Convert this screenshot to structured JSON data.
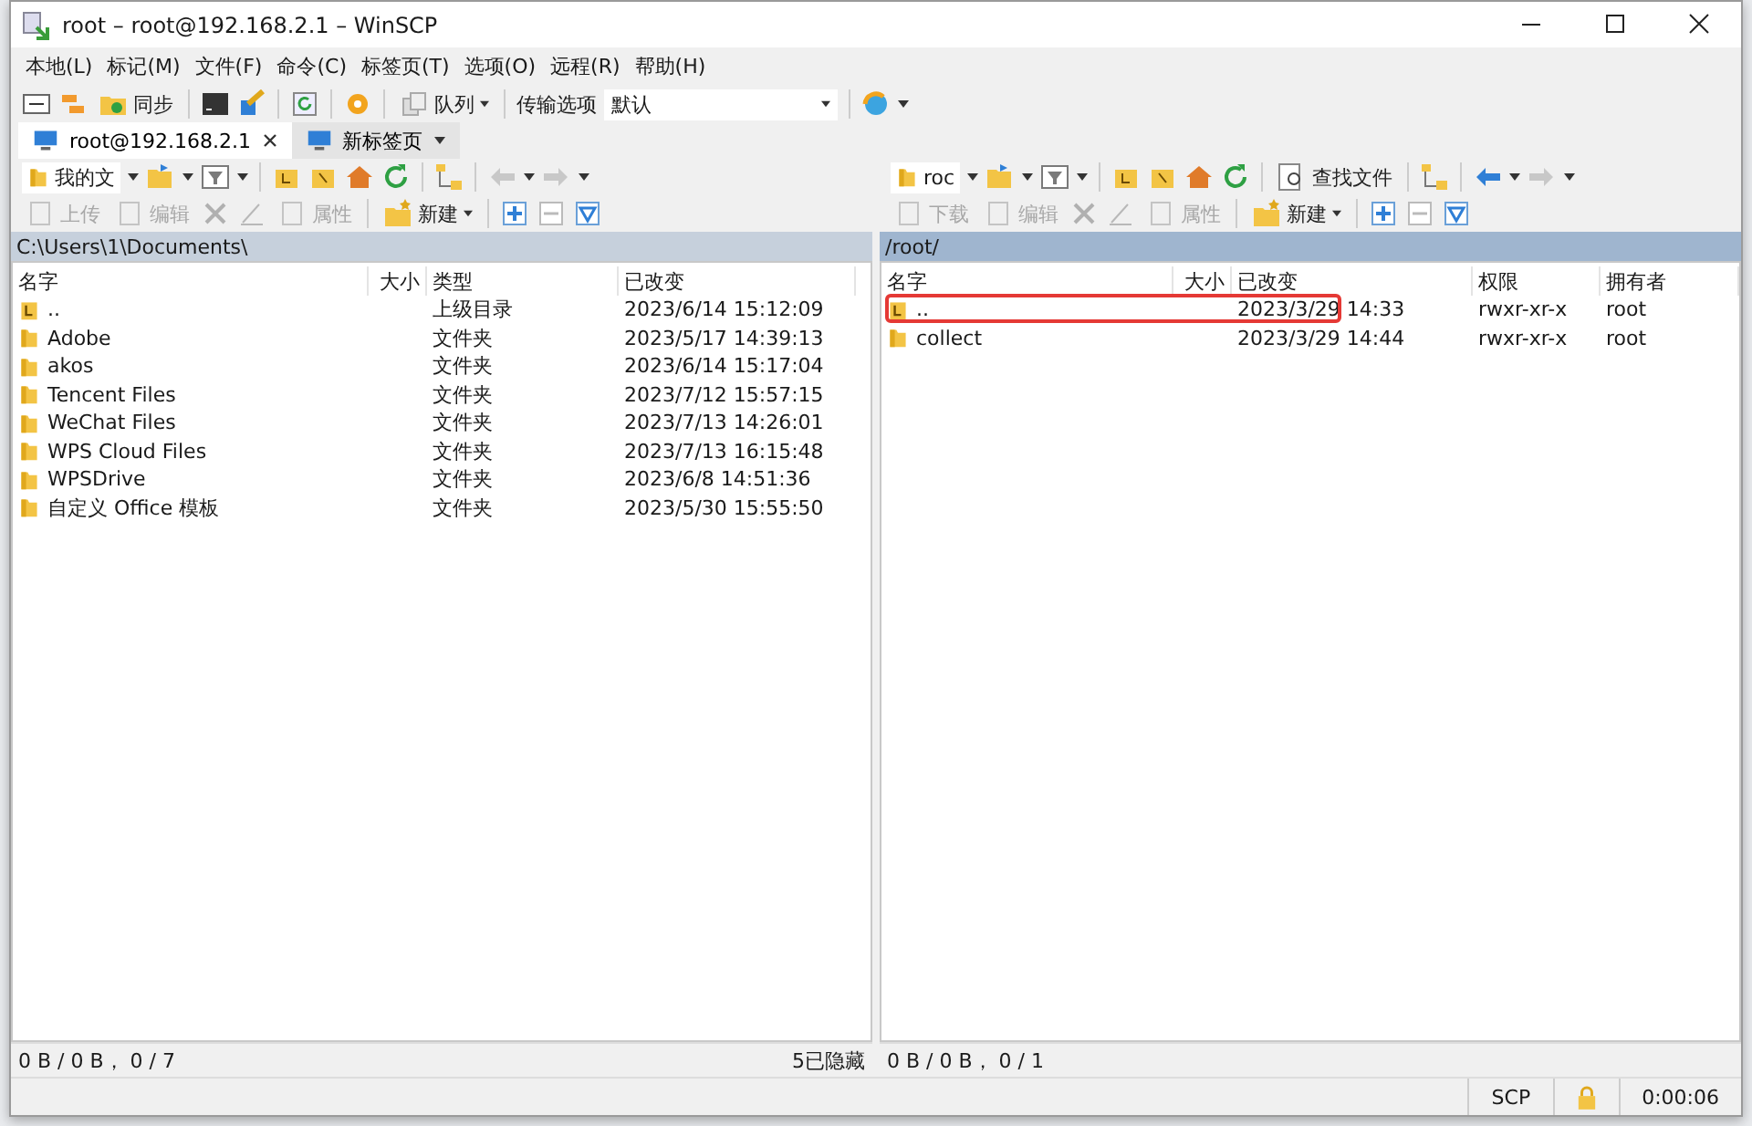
{
  "window": {
    "title": "root – root@192.168.2.1 – WinSCP"
  },
  "menu": [
    "本地(L)",
    "标记(M)",
    "文件(F)",
    "命令(C)",
    "标签页(T)",
    "选项(O)",
    "远程(R)",
    "帮助(H)"
  ],
  "toolbar": {
    "sync_label": "同步",
    "queue_label": "队列",
    "transfer_label": "传输选项",
    "transfer_value": "默认"
  },
  "tabs": [
    {
      "label": "root@192.168.2.1",
      "selected": true
    },
    {
      "label": "新标签页",
      "selected": false
    }
  ],
  "panels": [
    {
      "location": "我的文",
      "actions": [
        {
          "label": "上传",
          "disabled": true
        },
        {
          "label": "编辑",
          "disabled": true
        },
        {
          "label": "属性",
          "disabled": true
        },
        {
          "label": "新建",
          "disabled": false
        }
      ],
      "path": "C:\\Users\\1\\Documents\\",
      "path_active": false,
      "columns": [
        "名字",
        "大小",
        "类型",
        "已改变"
      ],
      "rows": [
        {
          "kind": "parent",
          "cells": [
            "..",
            "",
            "上级目录",
            "2023/6/14 15:12:09"
          ],
          "annotated": false
        },
        {
          "kind": "folder",
          "cells": [
            "Adobe",
            "",
            "文件夹",
            "2023/5/17 14:39:13"
          ],
          "annotated": false
        },
        {
          "kind": "folder",
          "cells": [
            "akos",
            "",
            "文件夹",
            "2023/6/14 15:17:04"
          ],
          "annotated": false
        },
        {
          "kind": "folder",
          "cells": [
            "Tencent Files",
            "",
            "文件夹",
            "2023/7/12 15:57:15"
          ],
          "annotated": false
        },
        {
          "kind": "folder",
          "cells": [
            "WeChat Files",
            "",
            "文件夹",
            "2023/7/13 14:26:01"
          ],
          "annotated": false
        },
        {
          "kind": "folder",
          "cells": [
            "WPS Cloud Files",
            "",
            "文件夹",
            "2023/7/13 16:15:48"
          ],
          "annotated": false
        },
        {
          "kind": "folder",
          "cells": [
            "WPSDrive",
            "",
            "文件夹",
            "2023/6/8 14:51:36"
          ],
          "annotated": false
        },
        {
          "kind": "folder",
          "cells": [
            "自定义 Office 模板",
            "",
            "文件夹",
            "2023/5/30 15:55:50"
          ],
          "annotated": false
        }
      ],
      "status": "0 B / 0 B，  0 / 7",
      "hidden": "5已隐藏"
    },
    {
      "location": "roc",
      "find_label": "查找文件",
      "actions": [
        {
          "label": "下载",
          "disabled": true
        },
        {
          "label": "编辑",
          "disabled": true
        },
        {
          "label": "属性",
          "disabled": true
        },
        {
          "label": "新建",
          "disabled": false
        }
      ],
      "path": "/root/",
      "path_active": true,
      "columns": [
        "名字",
        "大小",
        "已改变",
        "权限",
        "拥有者"
      ],
      "rows": [
        {
          "kind": "parent",
          "cells": [
            "..",
            "",
            "2023/3/29 14:33",
            "rwxr-xr-x",
            "root"
          ],
          "annotated": true
        },
        {
          "kind": "folder",
          "cells": [
            "collect",
            "",
            "2023/3/29 14:44",
            "rwxr-xr-x",
            "root"
          ],
          "annotated": false
        }
      ],
      "status": "0 B / 0 B，  0 / 1"
    }
  ],
  "status_bar": {
    "protocol": "SCP",
    "elapsed": "0:00:06"
  }
}
